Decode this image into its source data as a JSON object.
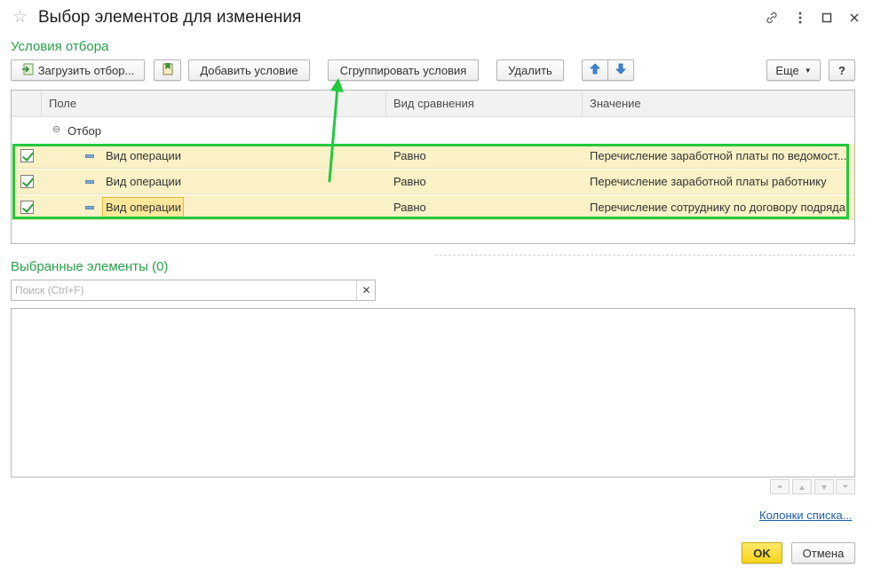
{
  "window": {
    "title": "Выбор элементов для изменения"
  },
  "filter_section": {
    "title": "Условия отбора",
    "toolbar": {
      "load_filter": "Загрузить отбор...",
      "add_condition": "Добавить условие",
      "group_conditions": "Сгруппировать условия",
      "delete": "Удалить",
      "more": "Еще",
      "help": "?"
    },
    "columns": [
      "Поле",
      "Вид сравнения",
      "Значение"
    ],
    "group_label": "Отбор",
    "rows": [
      {
        "field": "Вид операции",
        "comparison": "Равно",
        "value": "Перечисление заработной платы по ведомост...",
        "checked": true
      },
      {
        "field": "Вид операции",
        "comparison": "Равно",
        "value": "Перечисление заработной платы работнику",
        "checked": true
      },
      {
        "field": "Вид операции",
        "comparison": "Равно",
        "value": "Перечисление сотруднику по договору подряда",
        "checked": true
      }
    ]
  },
  "selected_section": {
    "title": "Выбранные элементы (0)",
    "search_placeholder": "Поиск (Ctrl+F)",
    "list_columns_link": "Колонки списка..."
  },
  "footer": {
    "ok": "OK",
    "cancel": "Отмена"
  },
  "icons": {
    "star": "star-icon",
    "link": "link-icon",
    "menu": "more-vertical-icon",
    "maximize": "maximize-icon",
    "close": "close-icon"
  },
  "colors": {
    "accent_green": "#2aa04a",
    "highlight_row": "#fbf1c6",
    "ok_button": "#ffe04d",
    "link_blue": "#1f5fa8",
    "annotation_green": "#22c93f"
  }
}
